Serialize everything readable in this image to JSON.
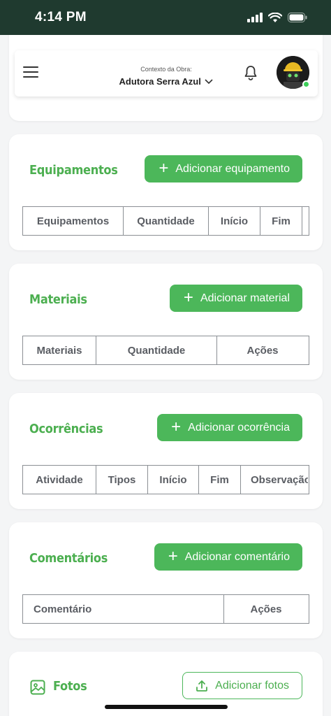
{
  "status": {
    "time": "4:14 PM"
  },
  "header": {
    "context_label": "Contexto da Obra:",
    "context_value": "Adutora Serra Azul"
  },
  "sections": {
    "equipamentos": {
      "title": "Equipamentos",
      "add_label": "Adicionar equipamento",
      "columns": [
        "Equipamentos",
        "Quantidade",
        "Início",
        "Fim"
      ]
    },
    "materiais": {
      "title": "Materiais",
      "add_label": "Adicionar material",
      "columns": [
        "Materiais",
        "Quantidade",
        "Ações"
      ]
    },
    "ocorrencias": {
      "title": "Ocorrências",
      "add_label": "Adicionar ocorrência",
      "columns": [
        "Atividade",
        "Tipos",
        "Início",
        "Fim",
        "Observação"
      ]
    },
    "comentarios": {
      "title": "Comentários",
      "add_label": "Adicionar comentário",
      "columns": [
        "Comentário",
        "Ações"
      ]
    },
    "fotos": {
      "title": "Fotos",
      "add_label": "Adicionar fotos"
    }
  },
  "colors": {
    "status_bar": "#1f3a2f",
    "accent": "#4cb75a",
    "title_green": "#4caf50",
    "online": "#3ecf5a"
  },
  "icons": [
    "menu-icon",
    "bell-icon",
    "avatar",
    "plus-icon",
    "image-icon",
    "upload-icon",
    "signal-icon",
    "wifi-icon",
    "battery-icon"
  ]
}
